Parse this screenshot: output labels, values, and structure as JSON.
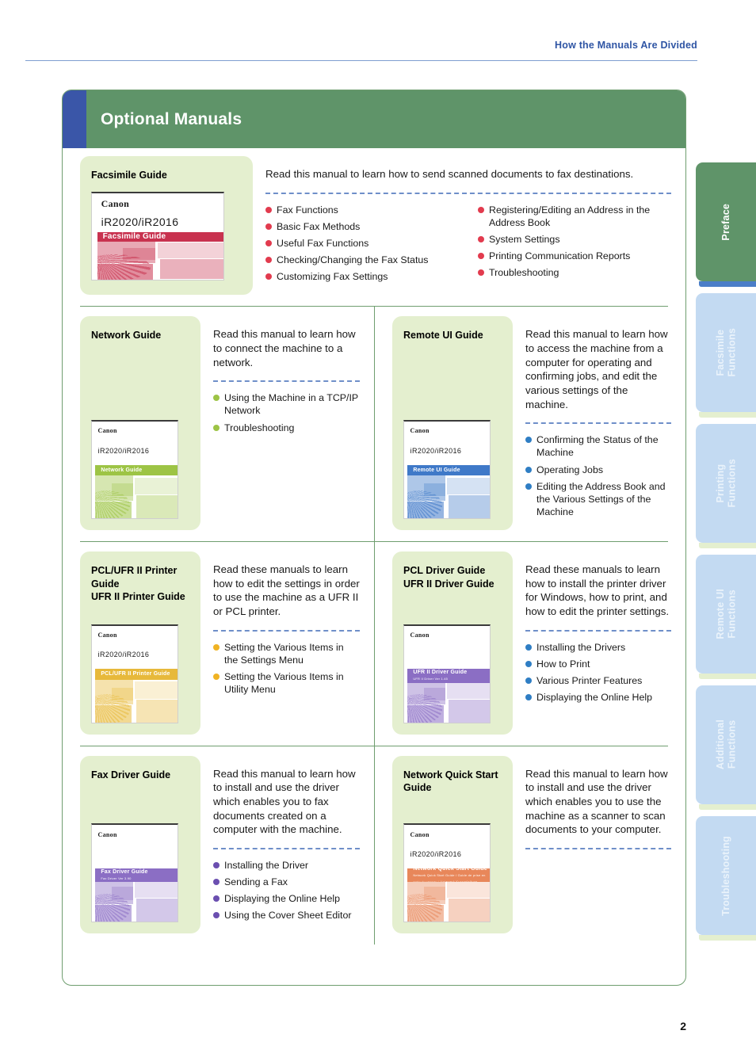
{
  "running_head": "How the Manuals Are Divided",
  "banner": {
    "title": "Optional Manuals"
  },
  "page_number": "2",
  "colors": {
    "accent_blue": "#3a56a8",
    "banner_green": "#5f9469",
    "card_green": "#e4efcf",
    "bullet_red": "#e23b4e",
    "bullet_green": "#9dc445",
    "bullet_blue": "#2f7ec4",
    "bullet_yellow": "#f0b323",
    "bullet_purple": "#6b4fb0",
    "tab_active": "#5f9469",
    "tab_idle": "#c3daf2"
  },
  "sections": [
    {
      "title": "Facsimile Guide",
      "lead": "Read this manual to learn how to send scanned documents to fax destinations.",
      "bullet_color": "#e23b4e",
      "cover": {
        "brand": "Canon",
        "model": "iR2020/iR2016",
        "band_text": "Facsimile Guide",
        "band_sub": "",
        "tint": "#c8324f"
      },
      "items_left": [
        "Fax Functions",
        "Basic Fax Methods",
        "Useful Fax Functions",
        "Checking/Changing the Fax Status",
        "Customizing Fax Settings"
      ],
      "items_right": [
        "Registering/Editing an Address in the Address Book",
        "System Settings",
        "Printing Communication Reports",
        "Troubleshooting"
      ]
    },
    {
      "title": "Network Guide",
      "lead": "Read this manual to learn how to connect the machine to a network.",
      "bullet_color": "#9dc445",
      "cover": {
        "brand": "Canon",
        "model": "iR2020/iR2016",
        "band_text": "Network Guide",
        "band_sub": "",
        "tint": "#9dc445"
      },
      "items": [
        "Using the Machine in a TCP/IP Network",
        "Troubleshooting"
      ]
    },
    {
      "title": "Remote UI Guide",
      "lead": "Read this manual to learn how to access the machine from a computer for operating and confirming jobs, and edit the various settings of the machine.",
      "bullet_color": "#2f7ec4",
      "cover": {
        "brand": "Canon",
        "model": "iR2020/iR2016",
        "band_text": "Remote UI Guide",
        "band_sub": "",
        "tint": "#3f79c8"
      },
      "items": [
        "Confirming the Status of the Machine",
        "Operating Jobs",
        "Editing the Address Book and the Various Settings of the Machine"
      ]
    },
    {
      "title": "PCL/UFR II Printer Guide\nUFR II Printer Guide",
      "lead": "Read these manuals to learn how to edit the settings in order to use the machine as a UFR II or PCL printer.",
      "bullet_color": "#f0b323",
      "cover": {
        "brand": "Canon",
        "model": "iR2020/iR2016",
        "band_text": "PCL/UFR II Printer Guide",
        "band_sub": "",
        "tint": "#e7b93b"
      },
      "items": [
        "Setting the Various Items in the Settings Menu",
        "Setting the Various Items in Utility Menu"
      ]
    },
    {
      "title": "PCL Driver Guide\nUFR II Driver Guide",
      "lead": "Read these manuals to learn how to install the printer driver for Windows, how to print, and how to edit the printer settings.",
      "bullet_color": "#2f7ec4",
      "cover": {
        "brand": "Canon",
        "model": "",
        "band_text": "UFR II Driver Guide",
        "band_sub": "UFR II Driver Ver 1.45",
        "tint": "#8b6ec4"
      },
      "items": [
        "Installing the Drivers",
        "How to Print",
        "Various Printer Features",
        "Displaying the Online Help"
      ]
    },
    {
      "title": "Fax Driver Guide",
      "lead": "Read this manual to learn how to install and use the driver which enables you to fax documents created on a computer with the machine.",
      "bullet_color": "#6b4fb0",
      "cover": {
        "brand": "Canon",
        "model": "",
        "band_text": "Fax Driver Guide",
        "band_sub": "Fax Driver Ver 3.90",
        "tint": "#8b6ec4"
      },
      "items": [
        "Installing the Driver",
        "Sending a Fax",
        "Displaying the Online Help",
        "Using the Cover Sheet Editor"
      ]
    },
    {
      "title": "Network Quick Start Guide",
      "lead": "Read this manual to learn how to install and use the driver which enables you to use the machine as a scanner to scan documents to your computer.",
      "bullet_color": "#e98b5a",
      "cover": {
        "brand": "Canon",
        "model": "iR2020/iR2016",
        "band_text": "Network Quick Start Guide",
        "band_sub": "Network Quick Start Guide / Guide de prise en main du reseau / Netzwerk-Kurzanleitung",
        "tint": "#e8875a"
      },
      "items": []
    }
  ],
  "tabs": [
    {
      "label": "Preface",
      "active": true
    },
    {
      "label": "Facsimile\nFunctions",
      "active": false
    },
    {
      "label": "Printing\nFunctions",
      "active": false
    },
    {
      "label": "Remote UI\nFunctions",
      "active": false
    },
    {
      "label": "Additional\nFunctions",
      "active": false
    },
    {
      "label": "Troubleshooting",
      "active": false
    }
  ]
}
